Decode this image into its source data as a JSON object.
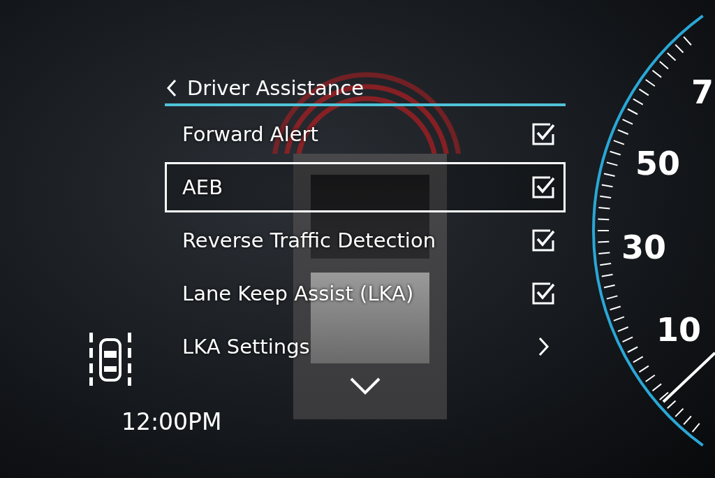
{
  "header": {
    "title": "Driver Assistance"
  },
  "items": [
    {
      "label": "Forward Alert",
      "kind": "checkbox",
      "checked": true,
      "selected": false
    },
    {
      "label": "AEB",
      "kind": "checkbox",
      "checked": true,
      "selected": true
    },
    {
      "label": "Reverse Traffic Detection",
      "kind": "checkbox",
      "checked": true,
      "selected": false
    },
    {
      "label": "Lane Keep Assist (LKA)",
      "kind": "checkbox",
      "checked": true,
      "selected": false
    },
    {
      "label": "LKA Settings",
      "kind": "submenu",
      "selected": false
    }
  ],
  "clock": "12:00PM",
  "gauge": {
    "labels": [
      "7",
      "50",
      "30",
      "10"
    ]
  }
}
